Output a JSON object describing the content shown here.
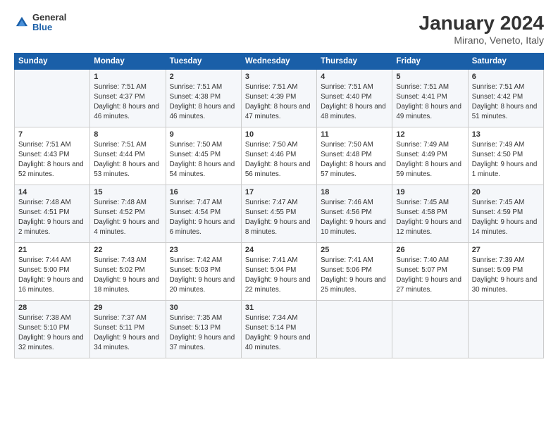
{
  "logo": {
    "general": "General",
    "blue": "Blue"
  },
  "title": "January 2024",
  "subtitle": "Mirano, Veneto, Italy",
  "headers": [
    "Sunday",
    "Monday",
    "Tuesday",
    "Wednesday",
    "Thursday",
    "Friday",
    "Saturday"
  ],
  "weeks": [
    [
      {
        "day": "",
        "sunrise": "",
        "sunset": "",
        "daylight": ""
      },
      {
        "day": "1",
        "sunrise": "Sunrise: 7:51 AM",
        "sunset": "Sunset: 4:37 PM",
        "daylight": "Daylight: 8 hours and 46 minutes."
      },
      {
        "day": "2",
        "sunrise": "Sunrise: 7:51 AM",
        "sunset": "Sunset: 4:38 PM",
        "daylight": "Daylight: 8 hours and 46 minutes."
      },
      {
        "day": "3",
        "sunrise": "Sunrise: 7:51 AM",
        "sunset": "Sunset: 4:39 PM",
        "daylight": "Daylight: 8 hours and 47 minutes."
      },
      {
        "day": "4",
        "sunrise": "Sunrise: 7:51 AM",
        "sunset": "Sunset: 4:40 PM",
        "daylight": "Daylight: 8 hours and 48 minutes."
      },
      {
        "day": "5",
        "sunrise": "Sunrise: 7:51 AM",
        "sunset": "Sunset: 4:41 PM",
        "daylight": "Daylight: 8 hours and 49 minutes."
      },
      {
        "day": "6",
        "sunrise": "Sunrise: 7:51 AM",
        "sunset": "Sunset: 4:42 PM",
        "daylight": "Daylight: 8 hours and 51 minutes."
      }
    ],
    [
      {
        "day": "7",
        "sunrise": "Sunrise: 7:51 AM",
        "sunset": "Sunset: 4:43 PM",
        "daylight": "Daylight: 8 hours and 52 minutes."
      },
      {
        "day": "8",
        "sunrise": "Sunrise: 7:51 AM",
        "sunset": "Sunset: 4:44 PM",
        "daylight": "Daylight: 8 hours and 53 minutes."
      },
      {
        "day": "9",
        "sunrise": "Sunrise: 7:50 AM",
        "sunset": "Sunset: 4:45 PM",
        "daylight": "Daylight: 8 hours and 54 minutes."
      },
      {
        "day": "10",
        "sunrise": "Sunrise: 7:50 AM",
        "sunset": "Sunset: 4:46 PM",
        "daylight": "Daylight: 8 hours and 56 minutes."
      },
      {
        "day": "11",
        "sunrise": "Sunrise: 7:50 AM",
        "sunset": "Sunset: 4:48 PM",
        "daylight": "Daylight: 8 hours and 57 minutes."
      },
      {
        "day": "12",
        "sunrise": "Sunrise: 7:49 AM",
        "sunset": "Sunset: 4:49 PM",
        "daylight": "Daylight: 8 hours and 59 minutes."
      },
      {
        "day": "13",
        "sunrise": "Sunrise: 7:49 AM",
        "sunset": "Sunset: 4:50 PM",
        "daylight": "Daylight: 9 hours and 1 minute."
      }
    ],
    [
      {
        "day": "14",
        "sunrise": "Sunrise: 7:48 AM",
        "sunset": "Sunset: 4:51 PM",
        "daylight": "Daylight: 9 hours and 2 minutes."
      },
      {
        "day": "15",
        "sunrise": "Sunrise: 7:48 AM",
        "sunset": "Sunset: 4:52 PM",
        "daylight": "Daylight: 9 hours and 4 minutes."
      },
      {
        "day": "16",
        "sunrise": "Sunrise: 7:47 AM",
        "sunset": "Sunset: 4:54 PM",
        "daylight": "Daylight: 9 hours and 6 minutes."
      },
      {
        "day": "17",
        "sunrise": "Sunrise: 7:47 AM",
        "sunset": "Sunset: 4:55 PM",
        "daylight": "Daylight: 9 hours and 8 minutes."
      },
      {
        "day": "18",
        "sunrise": "Sunrise: 7:46 AM",
        "sunset": "Sunset: 4:56 PM",
        "daylight": "Daylight: 9 hours and 10 minutes."
      },
      {
        "day": "19",
        "sunrise": "Sunrise: 7:45 AM",
        "sunset": "Sunset: 4:58 PM",
        "daylight": "Daylight: 9 hours and 12 minutes."
      },
      {
        "day": "20",
        "sunrise": "Sunrise: 7:45 AM",
        "sunset": "Sunset: 4:59 PM",
        "daylight": "Daylight: 9 hours and 14 minutes."
      }
    ],
    [
      {
        "day": "21",
        "sunrise": "Sunrise: 7:44 AM",
        "sunset": "Sunset: 5:00 PM",
        "daylight": "Daylight: 9 hours and 16 minutes."
      },
      {
        "day": "22",
        "sunrise": "Sunrise: 7:43 AM",
        "sunset": "Sunset: 5:02 PM",
        "daylight": "Daylight: 9 hours and 18 minutes."
      },
      {
        "day": "23",
        "sunrise": "Sunrise: 7:42 AM",
        "sunset": "Sunset: 5:03 PM",
        "daylight": "Daylight: 9 hours and 20 minutes."
      },
      {
        "day": "24",
        "sunrise": "Sunrise: 7:41 AM",
        "sunset": "Sunset: 5:04 PM",
        "daylight": "Daylight: 9 hours and 22 minutes."
      },
      {
        "day": "25",
        "sunrise": "Sunrise: 7:41 AM",
        "sunset": "Sunset: 5:06 PM",
        "daylight": "Daylight: 9 hours and 25 minutes."
      },
      {
        "day": "26",
        "sunrise": "Sunrise: 7:40 AM",
        "sunset": "Sunset: 5:07 PM",
        "daylight": "Daylight: 9 hours and 27 minutes."
      },
      {
        "day": "27",
        "sunrise": "Sunrise: 7:39 AM",
        "sunset": "Sunset: 5:09 PM",
        "daylight": "Daylight: 9 hours and 30 minutes."
      }
    ],
    [
      {
        "day": "28",
        "sunrise": "Sunrise: 7:38 AM",
        "sunset": "Sunset: 5:10 PM",
        "daylight": "Daylight: 9 hours and 32 minutes."
      },
      {
        "day": "29",
        "sunrise": "Sunrise: 7:37 AM",
        "sunset": "Sunset: 5:11 PM",
        "daylight": "Daylight: 9 hours and 34 minutes."
      },
      {
        "day": "30",
        "sunrise": "Sunrise: 7:35 AM",
        "sunset": "Sunset: 5:13 PM",
        "daylight": "Daylight: 9 hours and 37 minutes."
      },
      {
        "day": "31",
        "sunrise": "Sunrise: 7:34 AM",
        "sunset": "Sunset: 5:14 PM",
        "daylight": "Daylight: 9 hours and 40 minutes."
      },
      {
        "day": "",
        "sunrise": "",
        "sunset": "",
        "daylight": ""
      },
      {
        "day": "",
        "sunrise": "",
        "sunset": "",
        "daylight": ""
      },
      {
        "day": "",
        "sunrise": "",
        "sunset": "",
        "daylight": ""
      }
    ]
  ]
}
